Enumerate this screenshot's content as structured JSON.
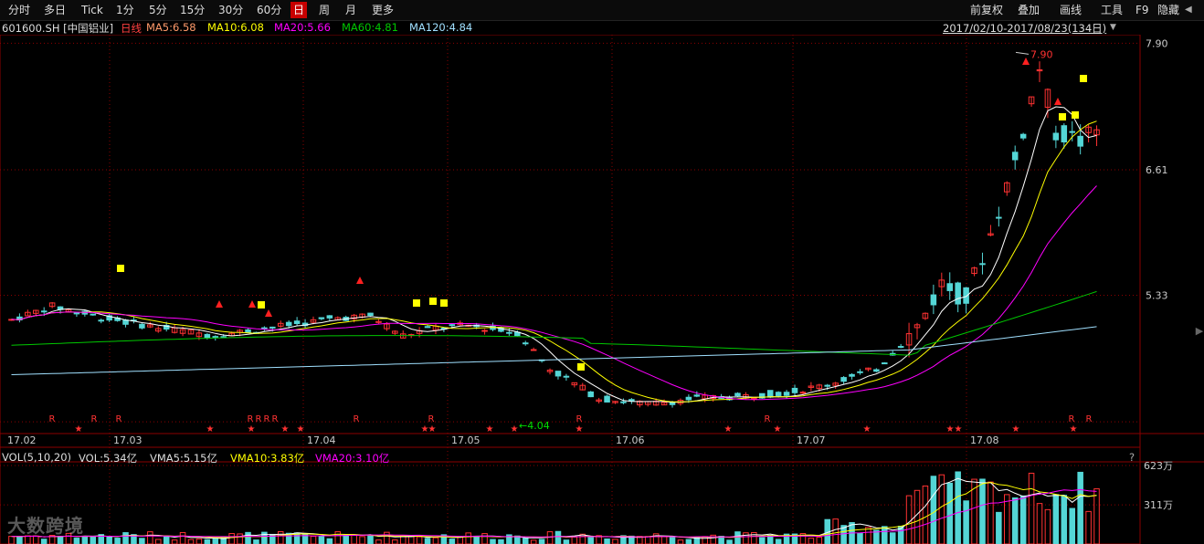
{
  "toolbar": {
    "tabs": [
      "分时",
      "多日",
      "Tick",
      "1分",
      "5分",
      "15分",
      "30分",
      "60分",
      "日",
      "周",
      "月",
      "更多"
    ],
    "active_tab": "日",
    "right_items": [
      "前复权",
      "叠加",
      "画线",
      "工具",
      "F9",
      "隐藏"
    ]
  },
  "info": {
    "symbol": "601600.SH [中国铝业]",
    "period": "日线",
    "ma5": "MA5:6.58",
    "ma10": "MA10:6.08",
    "ma20": "MA20:5.66",
    "ma60": "MA60:4.81",
    "ma120": "MA120:4.84",
    "range": "2017/02/10-2017/08/23(134日)"
  },
  "colors": {
    "up": "#ff3232",
    "down": "#54d6d6",
    "ma5": "#ffffff",
    "ma10": "#ffff00",
    "ma20": "#ff00ff",
    "ma60": "#00c800",
    "ma120": "#a0e0ff",
    "grid": "#8b0000"
  },
  "vol_info": {
    "title": "VOL(5,10,20)",
    "vol": "VOL:5.34亿",
    "vma5": "VMA5:5.15亿",
    "vma10": "VMA10:3.83亿",
    "vma20": "VMA20:3.10亿"
  },
  "watermark": "大数跨境",
  "chart_data": {
    "type": "candlestick",
    "price_ticks": [
      "7.90",
      "6.61",
      "5.33"
    ],
    "volume_ticks": [
      "623万",
      "311万"
    ],
    "x_labels": [
      "17.02",
      "17.03",
      "17.04",
      "17.05",
      "17.06",
      "17.07",
      "17.08"
    ],
    "annotations": [
      {
        "label": "7.90",
        "type": "high"
      },
      {
        "label": "4.04",
        "type": "low"
      }
    ],
    "ylim": [
      3.92,
      7.95
    ],
    "volume_max": 623
  }
}
